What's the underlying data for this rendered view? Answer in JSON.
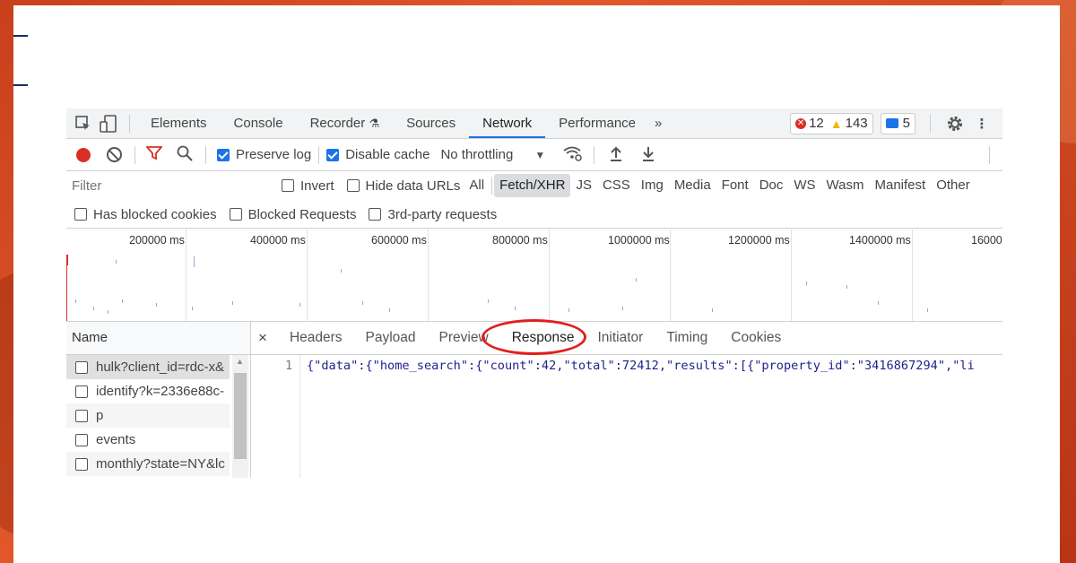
{
  "devtools": {
    "tabs": [
      "Elements",
      "Console",
      "Recorder",
      "Sources",
      "Network",
      "Performance"
    ],
    "active_tab": "Network",
    "more_tabs": "»",
    "errors": "12",
    "warnings": "143",
    "messages": "5",
    "toolbar": {
      "preserve_log": "Preserve log",
      "disable_cache": "Disable cache",
      "throttling": "No throttling"
    },
    "filter": {
      "placeholder": "Filter",
      "invert": "Invert",
      "hide_data_urls": "Hide data URLs",
      "types": [
        "All",
        "Fetch/XHR",
        "JS",
        "CSS",
        "Img",
        "Media",
        "Font",
        "Doc",
        "WS",
        "Wasm",
        "Manifest",
        "Other"
      ],
      "active_type": "Fetch/XHR"
    },
    "cookies": {
      "has_blocked_cookies": "Has blocked cookies",
      "blocked_requests": "Blocked Requests",
      "third_party": "3rd-party requests"
    },
    "timeline": {
      "ticks": [
        "200000 ms",
        "400000 ms",
        "600000 ms",
        "800000 ms",
        "1000000 ms",
        "1200000 ms",
        "1400000 ms",
        "16000"
      ]
    },
    "requests": {
      "header": "Name",
      "items": [
        "hulk?client_id=rdc-x&",
        "identify?k=2336e88c-",
        "p",
        "events",
        "monthly?state=NY&lc"
      ]
    },
    "detail": {
      "close": "×",
      "tabs": [
        "Headers",
        "Payload",
        "Preview",
        "Response",
        "Initiator",
        "Timing",
        "Cookies"
      ],
      "active_tab": "Response",
      "line_number": "1",
      "response_line": "{\"data\":{\"home_search\":{\"count\":42,\"total\":72412,\"results\":[{\"property_id\":\"3416867294\",\"li"
    }
  }
}
